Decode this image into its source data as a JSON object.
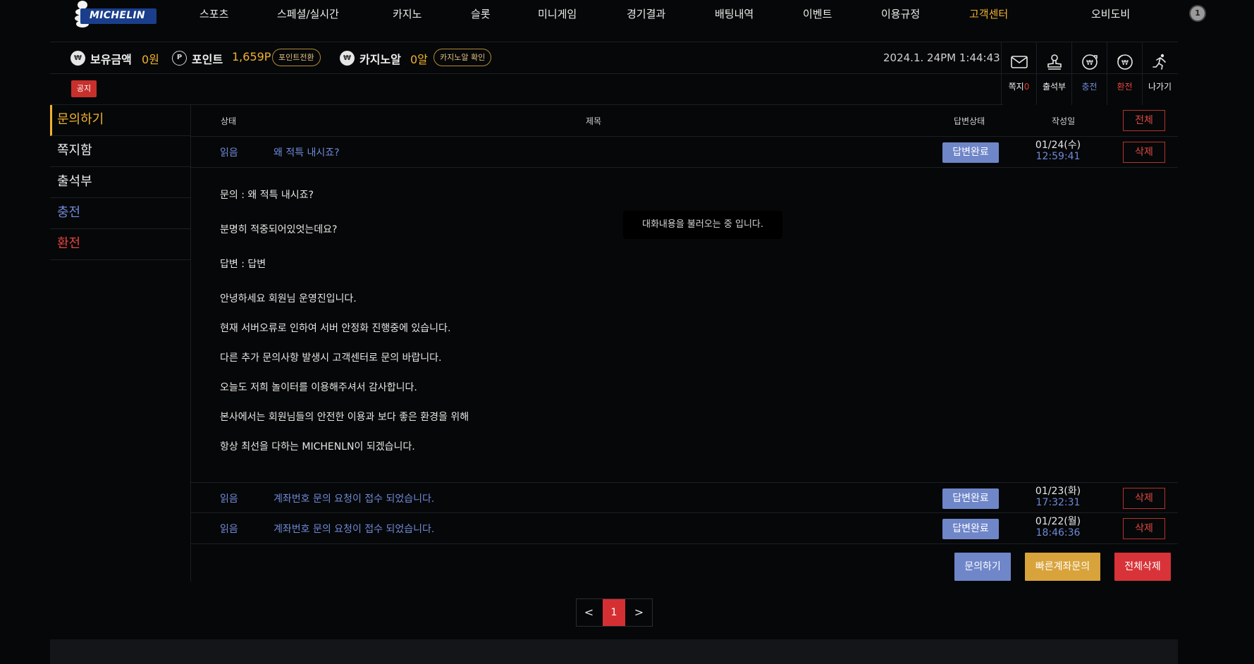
{
  "nav": {
    "logo": "MICHELIN",
    "menu": [
      "스포츠",
      "스페셜/실시간",
      "카지노",
      "슬롯",
      "미니게임",
      "경기결과",
      "배팅내역",
      "이벤트",
      "이용규정",
      "고객센터"
    ],
    "active_index": 9,
    "user_name": "오비도비",
    "user_level": "1",
    "colors": {
      "accent": "#f0b230",
      "link_blue": "#6f8ad8",
      "danger": "#e03a36"
    }
  },
  "info": {
    "balance_label": "보유금액",
    "balance_value": "0원",
    "point_label": "포인트",
    "point_value": "1,659P",
    "point_button": "포인트전환",
    "casino_label": "카지노알",
    "casino_value": "0알",
    "casino_button": "카지노알 확인",
    "datetime": "2024.1. 24PM 1:44:43",
    "coin_w": "₩",
    "coin_p": "P"
  },
  "notice": {
    "badge": "공지"
  },
  "quick": {
    "message_label": "쪽지",
    "message_count": "0",
    "attendance_label": "출석부",
    "deposit_label": "충전",
    "withdraw_label": "환전",
    "logout_label": "나가기"
  },
  "sidebar": {
    "items": [
      {
        "label": "문의하기"
      },
      {
        "label": "쪽지함"
      },
      {
        "label": "출석부"
      },
      {
        "label": "충전"
      },
      {
        "label": "환전"
      }
    ]
  },
  "table": {
    "headers": {
      "status": "상태",
      "title": "제목",
      "reply_status": "답변상태",
      "date": "작성일",
      "all_button": "전체"
    },
    "rows": [
      {
        "status": "읽음",
        "title": "왜 적특 내시죠?",
        "badge": "답변완료",
        "date": "01/24(수)",
        "time": "12:59:41",
        "delete": "삭제"
      },
      {
        "status": "읽음",
        "title": "계좌번호 문의 요청이 접수 되었습니다.",
        "badge": "답변완료",
        "date": "01/23(화)",
        "time": "17:32:31",
        "delete": "삭제"
      },
      {
        "status": "읽음",
        "title": "계좌번호 문의 요청이 접수 되었습니다.",
        "badge": "답변완료",
        "date": "01/22(월)",
        "time": "18:46:36",
        "delete": "삭제"
      }
    ],
    "detail": {
      "question": "문의 : 왜 적특 내시죠?",
      "question_body": "분명히 적중되어있엇는데요?",
      "answer": "답변 : 답변",
      "lines": [
        "안녕하세요 회원님 운영진입니다.",
        "현재 서버오류로 인하여 서버 안정화 진행중에 있습니다.",
        "다른 추가 문의사항 발생시 고객센터로 문의 바랍니다.",
        "오늘도 저희 놀이터를 이용해주셔서 감사합니다.",
        "본사에서는 회원님들의 안전한 이용과 보다 좋은 환경을 위해",
        "항상 최선을 다하는 MICHENLN이 되겠습니다."
      ],
      "loading": "대화내용을 불러오는 중 입니다."
    }
  },
  "actions": {
    "inquiry": "문의하기",
    "quick_account": "빠른계좌문의",
    "delete_all": "전체삭제"
  },
  "pager": {
    "prev": "<",
    "current": "1",
    "next": ">"
  }
}
